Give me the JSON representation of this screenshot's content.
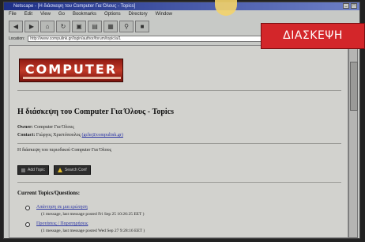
{
  "window": {
    "title": "Netscape - [Η διάσκεψη του Computer Για Όλους - Topics]"
  },
  "menu": [
    "File",
    "Edit",
    "View",
    "Go",
    "Bookmarks",
    "Options",
    "Directory",
    "Window"
  ],
  "toolbar": {
    "icons": [
      "back-icon",
      "forward-icon",
      "home-icon",
      "reload-icon",
      "images-icon",
      "open-icon",
      "print-icon",
      "find-icon",
      "stop-icon"
    ]
  },
  "location": {
    "label": "Location:",
    "url": "http://www.compulink.gr/login/author/forum/topic/a/1"
  },
  "banner": {
    "text": "ΔΙΑΣΚΕΨΗ"
  },
  "logo": {
    "text": "COMPUTER"
  },
  "page": {
    "title": "Η διάσκεψη του Computer Για Όλους - Topics",
    "owner_label": "Owner:",
    "owner_value": "Computer Για Όλους",
    "contact_label": "Contact:",
    "contact_value": "Γιώργος Χριστόπουλος",
    "contact_email": "(gchr@compulink.gr)",
    "description": "Η διάσκεψη του περιοδικού Computer Για Όλους",
    "buttons": [
      "Add Topic",
      "Search Conf"
    ],
    "section_title": "Current Topics/Questions:",
    "topics": [
      {
        "link": "Απάντηση σε μια ερώτηση",
        "info": "(1 message, last message posted Fri Sep 25 10:26:25 EET )"
      },
      {
        "link": "Προτάσεις / Παρατηρήσεις",
        "info": "(1 message, last message posted Wed Sep 27 9:28:16 EET )"
      }
    ]
  },
  "colors": {
    "banner": "#d3262a",
    "link": "#2a34a4",
    "titlebar": "#1d2f86"
  }
}
